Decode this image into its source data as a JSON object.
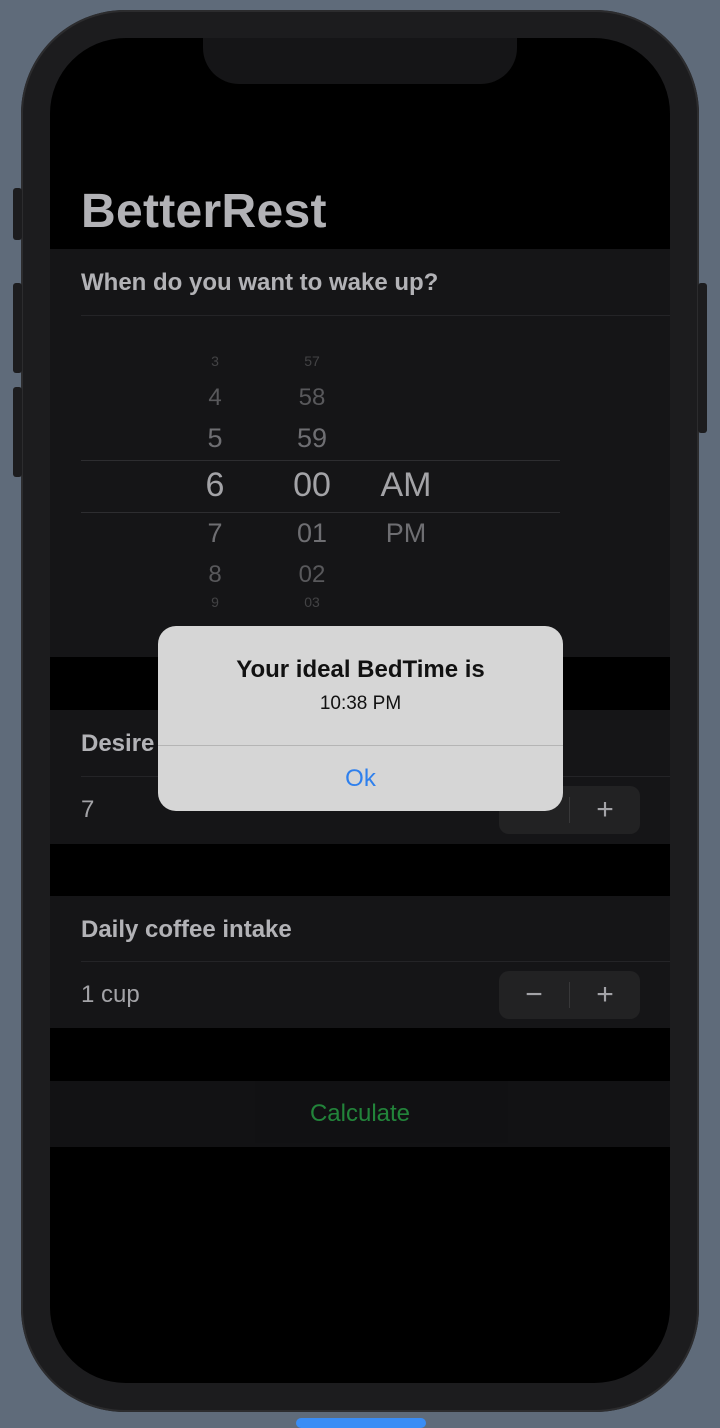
{
  "app": {
    "title": "BetterRest"
  },
  "wake_section": {
    "header": "When do you want to wake up?",
    "picker": {
      "hours": [
        "3",
        "4",
        "5",
        "6",
        "7",
        "8",
        "9"
      ],
      "minutes": [
        "57",
        "58",
        "59",
        "00",
        "01",
        "02",
        "03"
      ],
      "periods": [
        "AM",
        "PM"
      ],
      "selected_hour": "6",
      "selected_minute": "00",
      "selected_period": "AM"
    }
  },
  "sleep_section": {
    "header": "Desire",
    "value": "7",
    "stepper": {
      "minus": "−",
      "plus": "+"
    }
  },
  "coffee_section": {
    "header": "Daily coffee intake",
    "value": "1 cup",
    "stepper": {
      "minus": "−",
      "plus": "+"
    }
  },
  "calculate_button": {
    "label": "Calculate",
    "color": "#34c759"
  },
  "alert": {
    "title": "Your ideal BedTime is",
    "message": "10:38 PM",
    "ok_label": "Ok",
    "button_color": "#2f80ed"
  }
}
